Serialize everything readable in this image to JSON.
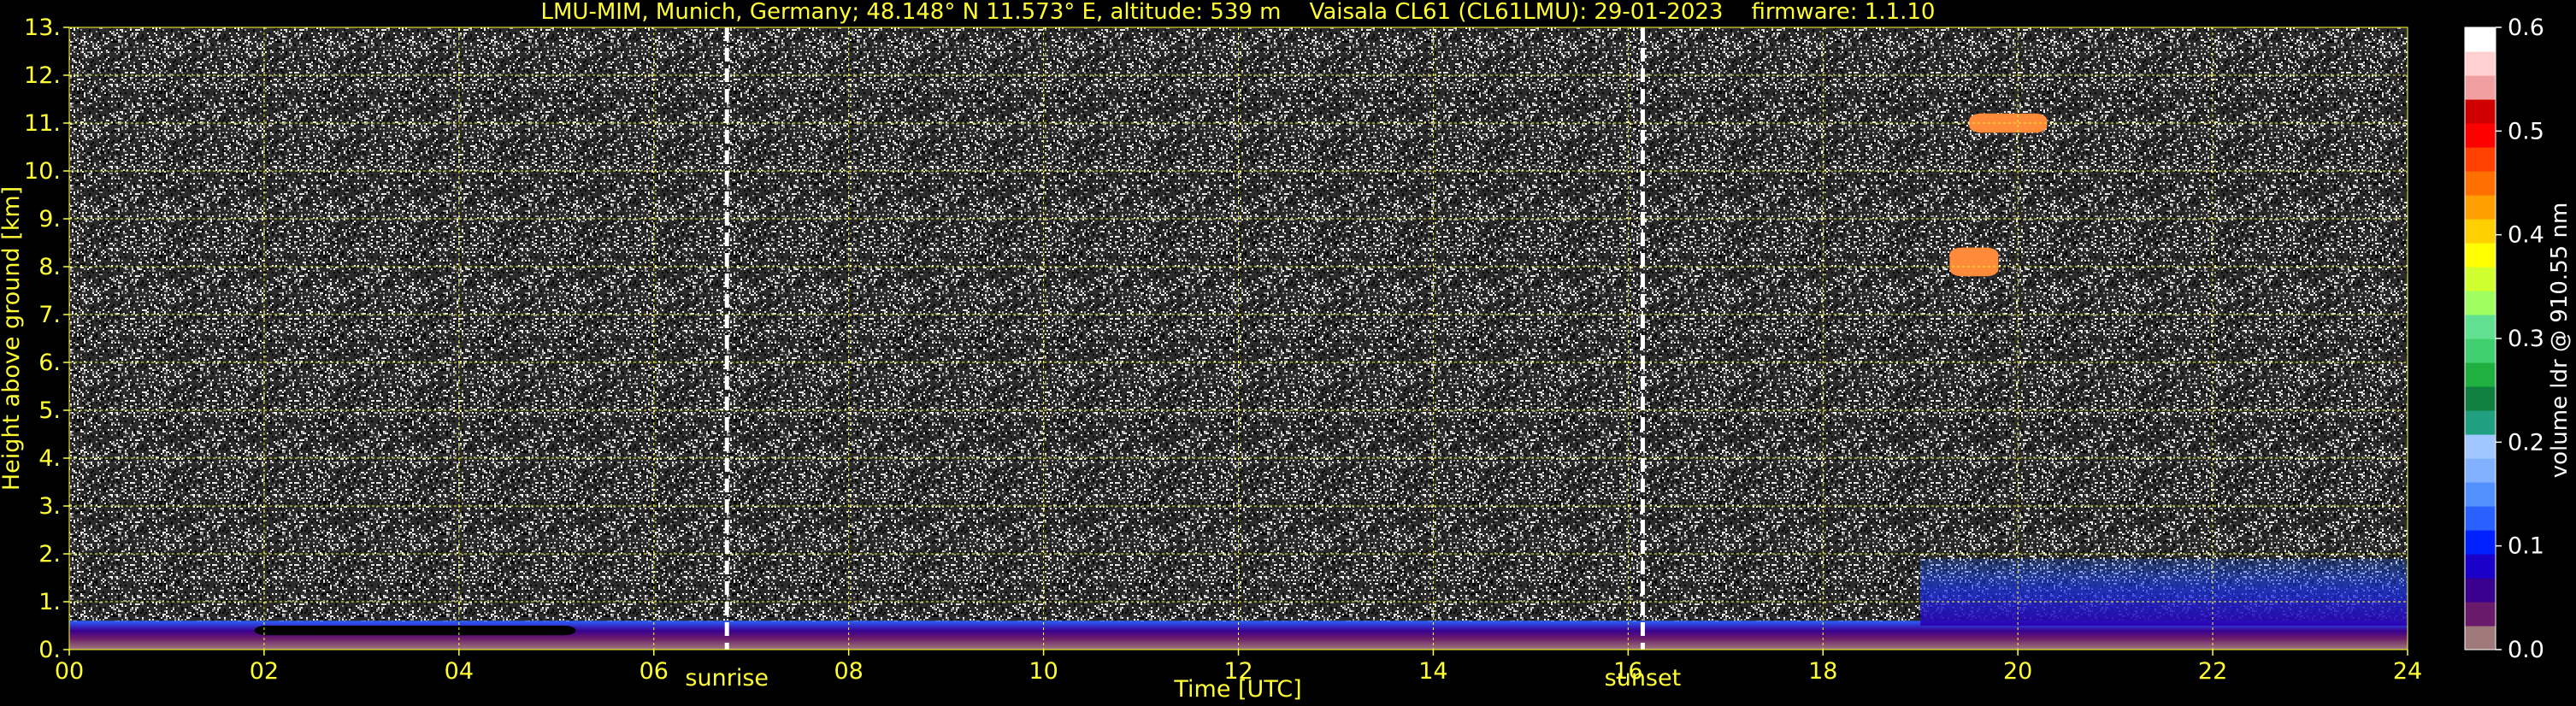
{
  "chart_data": {
    "type": "heatmap",
    "title": "LMU-MIM, Munich, Germany; 48.148° N 11.573° E, altitude: 539 m    Vaisala CL61 (CL61LMU): 29-01-2023    firmware: 1.1.10",
    "xlabel": "Time [UTC]",
    "ylabel": "Height above ground [km]",
    "xlim": [
      0,
      24
    ],
    "ylim": [
      0,
      13
    ],
    "x_ticks": [
      "00",
      "02",
      "04",
      "06",
      "08",
      "10",
      "12",
      "14",
      "16",
      "18",
      "20",
      "22",
      "24"
    ],
    "y_ticks": [
      "0.",
      "1.",
      "2.",
      "3.",
      "4.",
      "5.",
      "6.",
      "7.",
      "8.",
      "9.",
      "10.",
      "11.",
      "12.",
      "13."
    ],
    "grid": true,
    "colorbar": {
      "label": "volume ldr @ 910.55 nm",
      "range": [
        0.0,
        0.6
      ],
      "ticks": [
        "0.0",
        "0.1",
        "0.2",
        "0.3",
        "0.4",
        "0.5",
        "0.6"
      ],
      "colors": [
        "#a07a7a",
        "#6a1a6a",
        "#3a0090",
        "#1a00c8",
        "#0020ff",
        "#2a60ff",
        "#5090ff",
        "#80b0ff",
        "#a0c8ff",
        "#20a080",
        "#108040",
        "#20b040",
        "#40d070",
        "#60e090",
        "#a0ff60",
        "#d0ff30",
        "#ffff00",
        "#ffd000",
        "#ffa000",
        "#ff7000",
        "#ff4000",
        "#ff0000",
        "#d00000",
        "#f0a0a0",
        "#ffd0d0",
        "#ffffff"
      ]
    },
    "markers": [
      {
        "label": "sunrise",
        "x": 6.75
      },
      {
        "label": "sunset",
        "x": 16.15
      }
    ],
    "features": [
      {
        "name": "boundary-layer",
        "x": [
          0,
          24
        ],
        "y": [
          0,
          0.6
        ]
      },
      {
        "name": "elevated-aerosol",
        "x": [
          19,
          24
        ],
        "y": [
          0.5,
          1.9
        ]
      },
      {
        "name": "depolarizing-layer",
        "x": [
          1.9,
          5.2
        ],
        "y": [
          0.3,
          0.5
        ]
      },
      {
        "name": "ice-cloud",
        "x": [
          19.3,
          19.8
        ],
        "y": [
          7.8,
          8.4
        ]
      },
      {
        "name": "ice-cloud",
        "x": [
          19.5,
          20.3
        ],
        "y": [
          10.8,
          11.2
        ]
      }
    ]
  }
}
